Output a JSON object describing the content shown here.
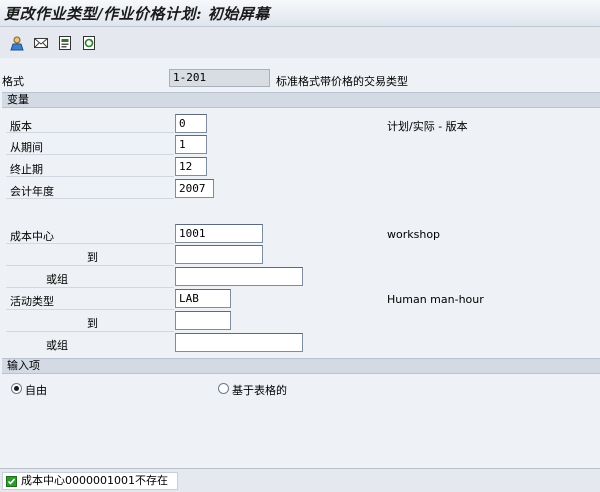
{
  "window": {
    "title": "更改作业类型/作业价格计划: 初始屏幕"
  },
  "toolbar": {
    "buttons": [
      {
        "icon": "user-icon"
      },
      {
        "icon": "mail-icon"
      },
      {
        "icon": "document-icon"
      },
      {
        "icon": "document-refresh-icon"
      }
    ]
  },
  "layout": {
    "label": "格式",
    "value": "1-201",
    "description": "标准格式带价格的交易类型"
  },
  "variables": {
    "header": "变量",
    "version": {
      "label": "版本",
      "value": "0",
      "description": "计划/实际 - 版本"
    },
    "from_period": {
      "label": "从期间",
      "value": "1"
    },
    "to_period": {
      "label": "终止期",
      "value": "12"
    },
    "fiscal_year": {
      "label": "会计年度",
      "value": "2007"
    },
    "cost_center": {
      "label": "成本中心",
      "value": "1001",
      "description": "workshop"
    },
    "cost_center_to": {
      "label": "到",
      "value": ""
    },
    "cost_center_group": {
      "label": "或组",
      "value": ""
    },
    "activity_type": {
      "label": "活动类型",
      "value": "LAB",
      "description": "Human man-hour"
    },
    "activity_type_to": {
      "label": "到",
      "value": ""
    },
    "activity_type_group": {
      "label": "或组",
      "value": ""
    }
  },
  "entry": {
    "header": "输入项",
    "options": [
      {
        "label": "自由",
        "selected": true
      },
      {
        "label": "基于表格的",
        "selected": false
      }
    ]
  },
  "status": {
    "icon": "success-check-icon",
    "message": "成本中心0000001001不存在"
  }
}
